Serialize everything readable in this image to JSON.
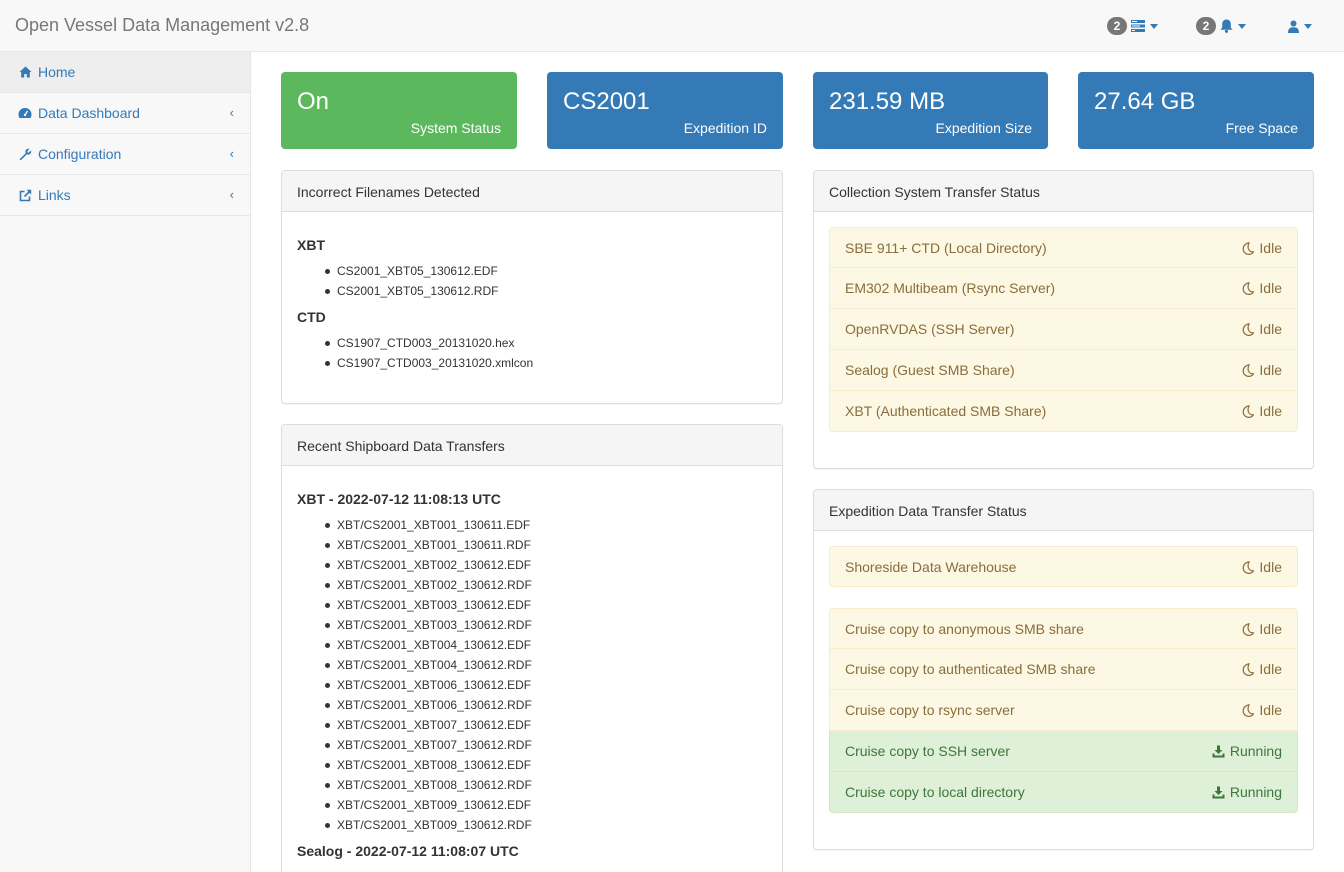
{
  "app": {
    "title": "Open Vessel Data Management v2.8"
  },
  "navbar": {
    "tasks_badge": "2",
    "alerts_badge": "2"
  },
  "sidebar": {
    "items": [
      {
        "label": "Home",
        "icon": "home-icon"
      },
      {
        "label": "Data Dashboard",
        "icon": "dashboard-icon"
      },
      {
        "label": "Configuration",
        "icon": "wrench-icon"
      },
      {
        "label": "Links",
        "icon": "external-link-icon"
      }
    ]
  },
  "stats": [
    {
      "value": "On",
      "label": "System Status",
      "color": "#5cb85c"
    },
    {
      "value": "CS2001",
      "label": "Expedition ID",
      "color": "#337ab7"
    },
    {
      "value": "231.59 MB",
      "label": "Expedition Size",
      "color": "#337ab7"
    },
    {
      "value": "27.64 GB",
      "label": "Free Space",
      "color": "#337ab7"
    }
  ],
  "incorrect_filenames": {
    "title": "Incorrect Filenames Detected",
    "groups": [
      {
        "name": "XBT",
        "files": [
          "CS2001_XBT05_130612.EDF",
          "CS2001_XBT05_130612.RDF"
        ]
      },
      {
        "name": "CTD",
        "files": [
          "CS1907_CTD003_20131020.hex",
          "CS1907_CTD003_20131020.xmlcon"
        ]
      }
    ]
  },
  "recent_transfers": {
    "title": "Recent Shipboard Data Transfers",
    "groups": [
      {
        "name": "XBT - 2022-07-12 11:08:13 UTC",
        "files": [
          "XBT/CS2001_XBT001_130611.EDF",
          "XBT/CS2001_XBT001_130611.RDF",
          "XBT/CS2001_XBT002_130612.EDF",
          "XBT/CS2001_XBT002_130612.RDF",
          "XBT/CS2001_XBT003_130612.EDF",
          "XBT/CS2001_XBT003_130612.RDF",
          "XBT/CS2001_XBT004_130612.EDF",
          "XBT/CS2001_XBT004_130612.RDF",
          "XBT/CS2001_XBT006_130612.EDF",
          "XBT/CS2001_XBT006_130612.RDF",
          "XBT/CS2001_XBT007_130612.EDF",
          "XBT/CS2001_XBT007_130612.RDF",
          "XBT/CS2001_XBT008_130612.EDF",
          "XBT/CS2001_XBT008_130612.RDF",
          "XBT/CS2001_XBT009_130612.EDF",
          "XBT/CS2001_XBT009_130612.RDF"
        ]
      },
      {
        "name": "Sealog - 2022-07-12 11:08:07 UTC",
        "files": []
      }
    ]
  },
  "collection_status": {
    "title": "Collection System Transfer Status",
    "items": [
      {
        "name": "SBE 911+ CTD (Local Directory)",
        "status": "Idle",
        "icon": "moon-icon"
      },
      {
        "name": "EM302 Multibeam (Rsync Server)",
        "status": "Idle",
        "icon": "moon-icon"
      },
      {
        "name": "OpenRVDAS (SSH Server)",
        "status": "Idle",
        "icon": "moon-icon"
      },
      {
        "name": "Sealog (Guest SMB Share)",
        "status": "Idle",
        "icon": "moon-icon"
      },
      {
        "name": "XBT (Authenticated SMB Share)",
        "status": "Idle",
        "icon": "moon-icon"
      }
    ]
  },
  "expedition_status": {
    "title": "Expedition Data Transfer Status",
    "warehouse": [
      {
        "name": "Shoreside Data Warehouse",
        "status": "Idle",
        "icon": "moon-icon"
      }
    ],
    "items": [
      {
        "name": "Cruise copy to anonymous SMB share",
        "status": "Idle",
        "icon": "moon-icon"
      },
      {
        "name": "Cruise copy to authenticated SMB share",
        "status": "Idle",
        "icon": "moon-icon"
      },
      {
        "name": "Cruise copy to rsync server",
        "status": "Idle",
        "icon": "moon-icon"
      },
      {
        "name": "Cruise copy to SSH server",
        "status": "Running",
        "icon": "download-icon"
      },
      {
        "name": "Cruise copy to local directory",
        "status": "Running",
        "icon": "download-icon"
      }
    ]
  }
}
